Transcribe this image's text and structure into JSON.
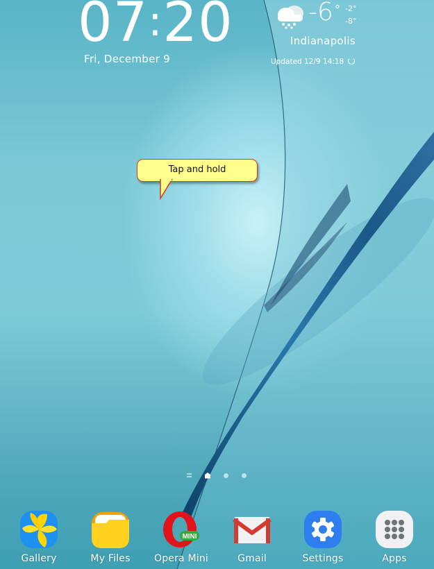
{
  "lockscreen_clock": {
    "hours": "07",
    "separator": ":",
    "minutes": "20",
    "date": "Fri, December 9"
  },
  "weather": {
    "icon": "snow-cloud-icon",
    "temperature": "-6",
    "degree_symbol": "°",
    "high": "-2°",
    "low": "-8°",
    "city": "Indianapolis",
    "updated": "Updated 12/9 14:18"
  },
  "tooltip": {
    "text": "Tap and hold"
  },
  "page_indicator": {
    "pages": [
      "list",
      "home",
      "page",
      "page"
    ],
    "current": "home"
  },
  "dock": {
    "apps": [
      {
        "label": "Gallery",
        "icon": "gallery-icon"
      },
      {
        "label": "My Files",
        "icon": "folder-icon"
      },
      {
        "label": "Opera Mini",
        "icon": "opera-mini-icon"
      },
      {
        "label": "Gmail",
        "icon": "gmail-icon"
      },
      {
        "label": "Settings",
        "icon": "gear-icon"
      },
      {
        "label": "Apps",
        "icon": "app-grid-icon"
      }
    ]
  },
  "colors": {
    "tooltip_bg": "#fffd8c",
    "tooltip_border": "#d83a1c",
    "wallpaper_base": "#6cc3d2",
    "ribbon": "#1f5f8f"
  }
}
